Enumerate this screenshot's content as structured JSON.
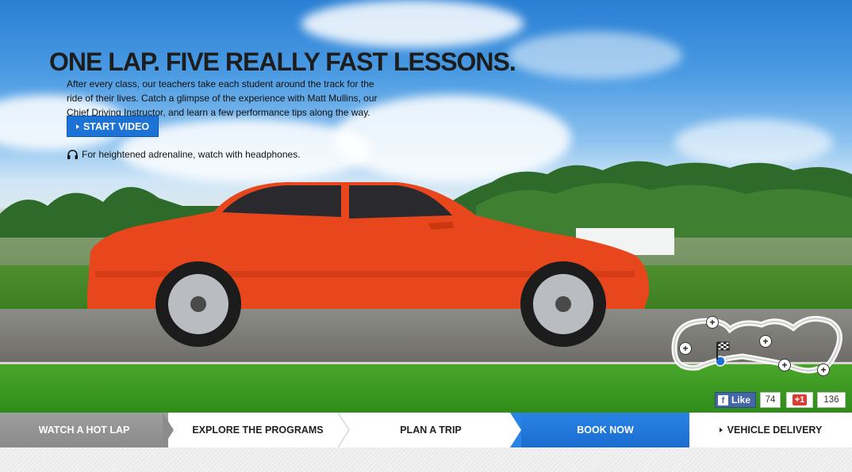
{
  "hero": {
    "headline": "ONE LAP. FIVE REALLY FAST LESSONS.",
    "intro": "After every class, our teachers take each student around the track for the ride of their lives. Catch a glimpse of the experience with Matt Mullins, our Chief Driving Instructor, and learn a few performance tips along the way.",
    "start_video_label": "START VIDEO",
    "headphones_note": "For heightened adrenaline, watch with headphones."
  },
  "social": {
    "facebook_like_label": "Like",
    "facebook_count": "74",
    "gplus_label": "+1",
    "gplus_count": "136"
  },
  "nav": {
    "items": [
      {
        "label": "WATCH A HOT LAP"
      },
      {
        "label": "EXPLORE THE PROGRAMS"
      },
      {
        "label": "PLAN A TRIP"
      },
      {
        "label": "BOOK NOW"
      },
      {
        "label": "VEHICLE DELIVERY"
      }
    ]
  },
  "colors": {
    "accent_blue": "#1d72d6",
    "car_orange": "#e8461c",
    "facebook_blue": "#4566a8",
    "gplus_red": "#d73d32"
  }
}
